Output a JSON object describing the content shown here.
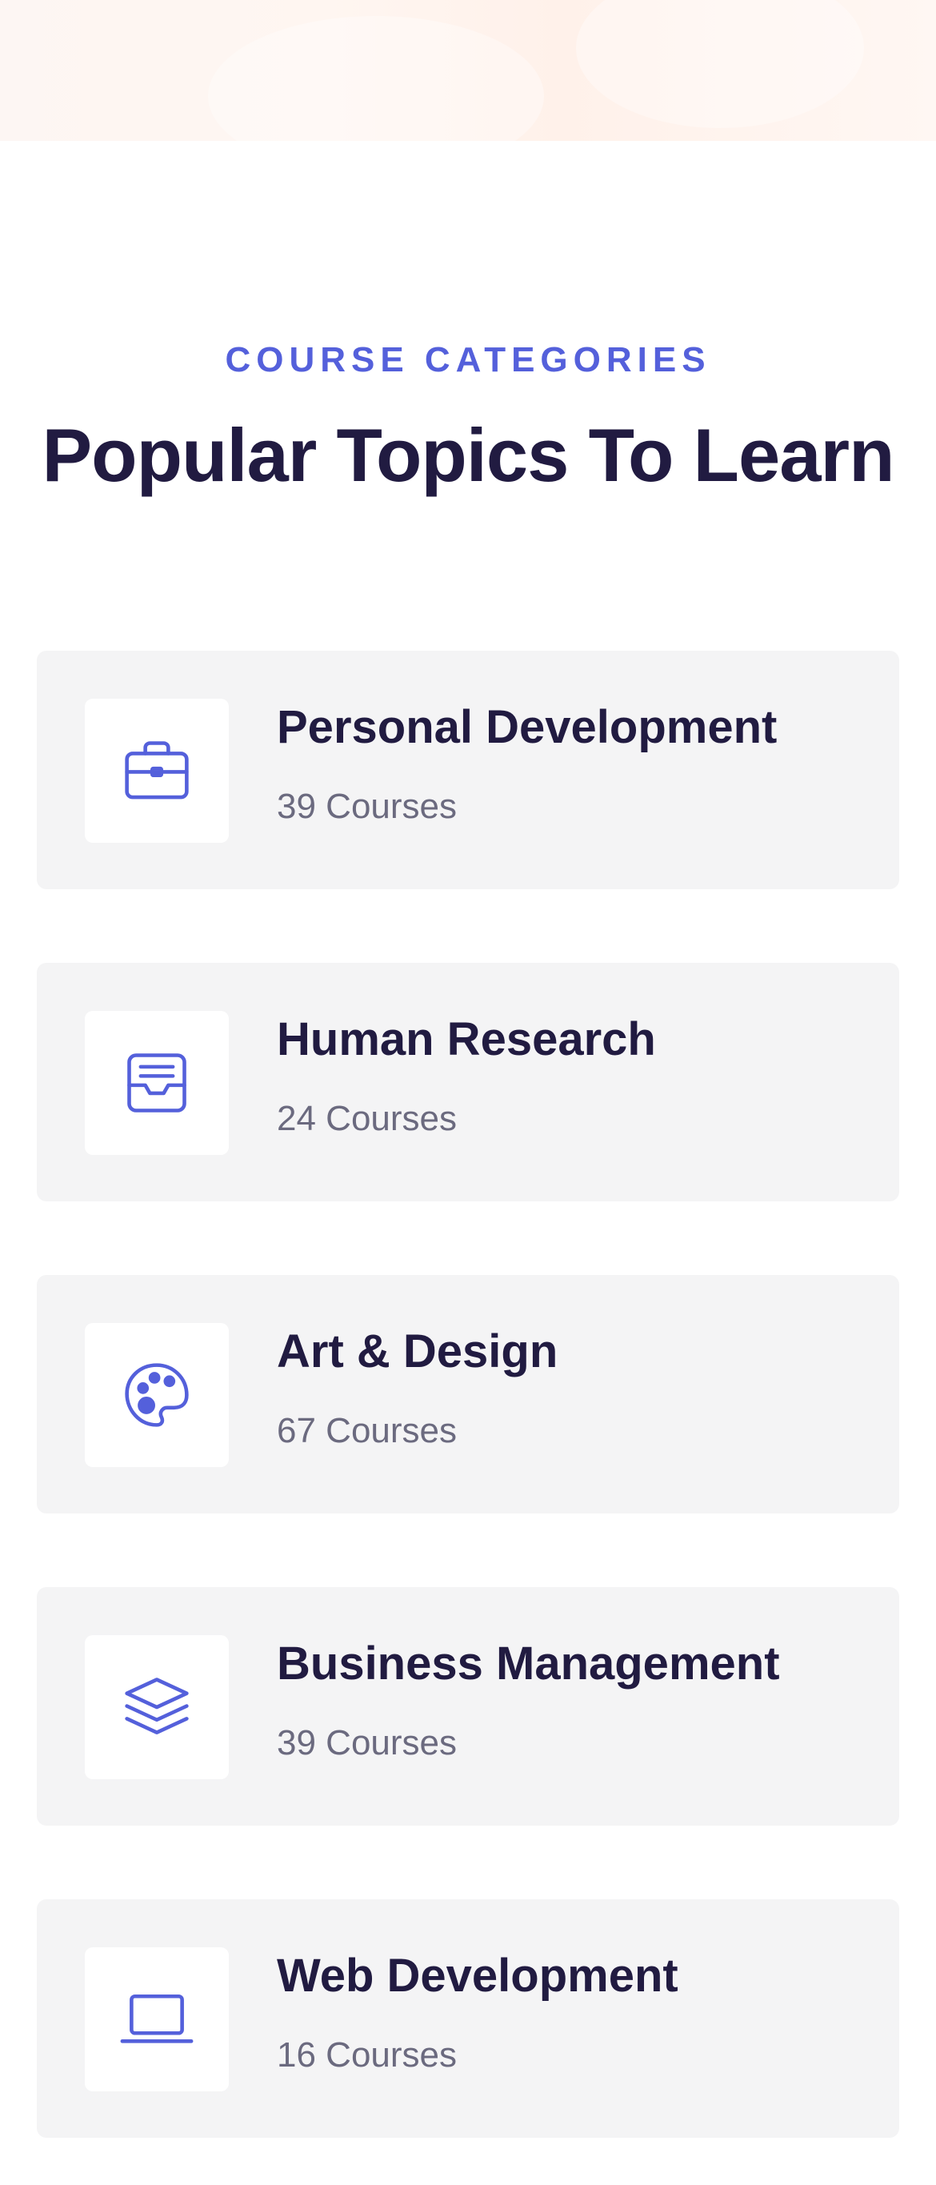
{
  "colors": {
    "accent": "#5460db",
    "heading": "#211b41",
    "muted": "#6b6a7f",
    "card_bg": "#f4f4f5",
    "hero_bg": "#fff6f1"
  },
  "section": {
    "eyebrow": "COURSE CATEGORIES",
    "title": "Popular Topics To Learn"
  },
  "categories": [
    {
      "title": "Personal Development",
      "count": "39 Courses",
      "icon": "briefcase-icon"
    },
    {
      "title": "Human Research",
      "count": "24 Courses",
      "icon": "inbox-icon"
    },
    {
      "title": "Art & Design",
      "count": "67 Courses",
      "icon": "palette-icon"
    },
    {
      "title": "Business Management",
      "count": "39 Courses",
      "icon": "layers-icon"
    },
    {
      "title": "Web Development",
      "count": "16 Courses",
      "icon": "laptop-icon"
    }
  ]
}
